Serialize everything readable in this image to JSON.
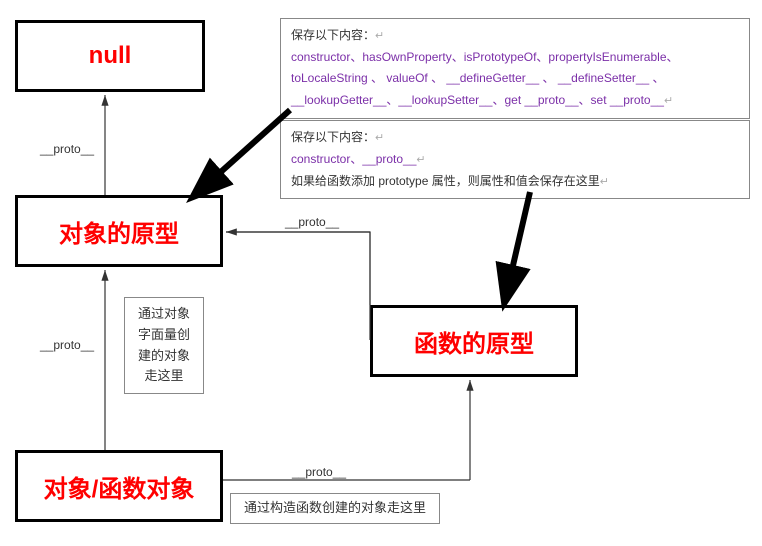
{
  "boxes": {
    "null_box": "null",
    "object_proto": "对象的原型",
    "function_proto": "函数的原型",
    "obj_func_obj": "对象/函数对象"
  },
  "labels": {
    "proto1": "__proto__",
    "proto2": "__proto__",
    "proto3": "__proto__",
    "proto4": "__proto__"
  },
  "info1": {
    "line1": "保存以下内容：",
    "line2": "constructor、hasOwnProperty、isPrototypeOf、propertyIsEnumerable、",
    "line3": "toLocaleString 、 valueOf 、 __defineGetter__ 、 __defineSetter__ 、",
    "line4": "__lookupGetter__、__lookupSetter__、get __proto__、set __proto__"
  },
  "info2": {
    "line1": "保存以下内容：",
    "line2": "constructor、__proto__",
    "line3": "如果给函数添加 prototype 属性，则属性和值会保存在这里"
  },
  "note1": "通过对象字面量创建的对象走这里",
  "note2": "通过构造函数创建的对象走这里"
}
